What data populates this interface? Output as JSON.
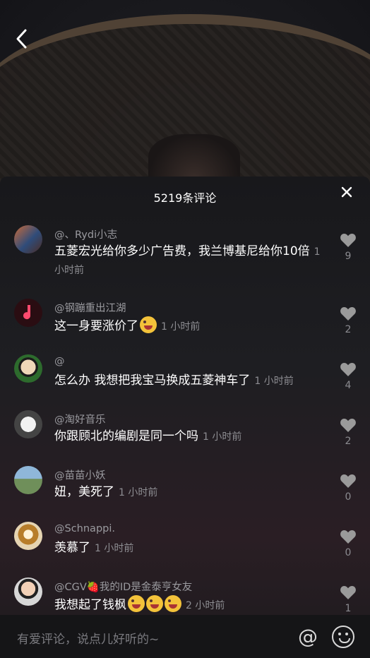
{
  "header": {
    "back_icon": "chevron-left-icon"
  },
  "panel": {
    "title": "5219条评论",
    "close_icon": "close-icon"
  },
  "comments": [
    {
      "user": "@、Rydi小志",
      "text": "五菱宏光给你多少广告费，我兰博基尼给你10倍",
      "time": "1 小时前",
      "likes": "9",
      "avatar": "avatar-collage"
    },
    {
      "user": "@钢蹦重出江湖",
      "text": "这一身要涨价了",
      "time": "1 小时前",
      "likes": "2",
      "emoji_count": 1,
      "avatar": "avatar-music-note"
    },
    {
      "user": "@",
      "text": "怎么办 我想把我宝马换成五菱神车了",
      "time": "1 小时前",
      "likes": "4",
      "avatar": "avatar-boy"
    },
    {
      "user": "@淘好音乐",
      "text": "你跟顾北的编剧是同一个吗",
      "time": "1 小时前",
      "likes": "2",
      "avatar": "avatar-phone"
    },
    {
      "user": "@苗苗小妖",
      "text": "妞，美死了",
      "time": "1 小时前",
      "likes": "0",
      "avatar": "avatar-landscape"
    },
    {
      "user": "@Schnappi.",
      "text": "羡慕了",
      "time": "1 小时前",
      "likes": "0",
      "avatar": "avatar-coffee"
    },
    {
      "user": "@CGV🍓我的ID是金泰亨女友",
      "text": "我想起了钱枫",
      "time": "2 小时前",
      "likes": "1",
      "emoji_count": 3,
      "avatar": "avatar-man"
    }
  ],
  "composer": {
    "placeholder": "有爱评论，说点儿好听的~",
    "at_icon": "at-icon",
    "emoji_icon": "emoji-icon"
  },
  "colors": {
    "heart": "#9a9a9a",
    "like_count": "#8b8b90",
    "username": "#9a9a9f"
  }
}
